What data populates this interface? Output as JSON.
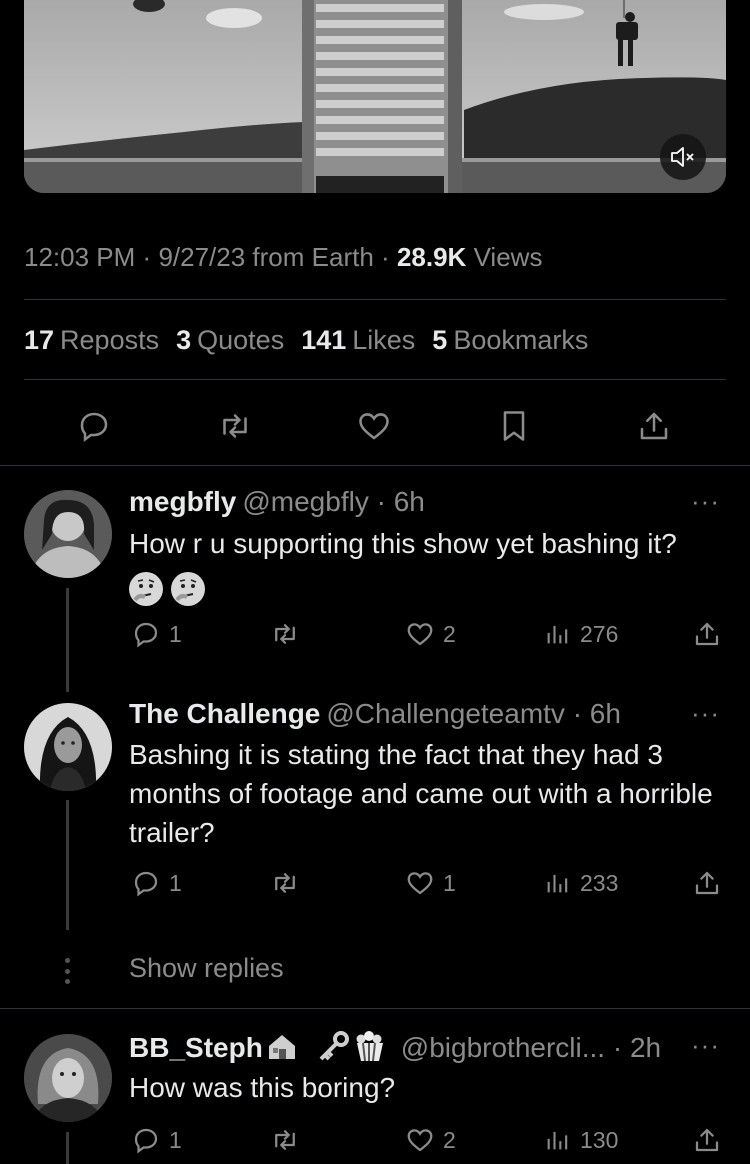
{
  "tweet": {
    "time": "12:03 PM",
    "date": "9/27/23",
    "source": "from Earth",
    "sep": "·",
    "views_count": "28.9K",
    "views_label": "Views"
  },
  "stats": {
    "reposts_count": "17",
    "reposts_label": "Reposts",
    "quotes_count": "3",
    "quotes_label": "Quotes",
    "likes_count": "141",
    "likes_label": "Likes",
    "bookmarks_count": "5",
    "bookmarks_label": "Bookmarks"
  },
  "action_bar": [
    "reply-icon",
    "repost-icon",
    "like-icon",
    "bookmark-icon",
    "share-icon"
  ],
  "replies": [
    {
      "name": "megbfly",
      "handle": "@megbfly · 6h",
      "text": "How r u supporting this show yet bashing it?",
      "emojis": [
        "thinking-face",
        "thinking-face"
      ],
      "reply_count": "1",
      "like_count": "2",
      "view_count": "276"
    },
    {
      "name": "The Challenge",
      "handle": "@Challengeteamtv · 6h",
      "text": "Bashing it is stating the fact that they had 3 months of footage and came out with a horrible trailer?",
      "reply_count": "1",
      "like_count": "1",
      "view_count": "233"
    },
    {
      "name": "BB_Steph",
      "name_emojis": [
        "house-icon",
        "key-icon",
        "popcorn-icon"
      ],
      "handle": "@bigbrothercli... · 2h",
      "text": "How was this boring?",
      "reply_count": "1",
      "like_count": "2",
      "view_count": "130"
    }
  ],
  "show_replies": "Show replies",
  "more_label": "···"
}
